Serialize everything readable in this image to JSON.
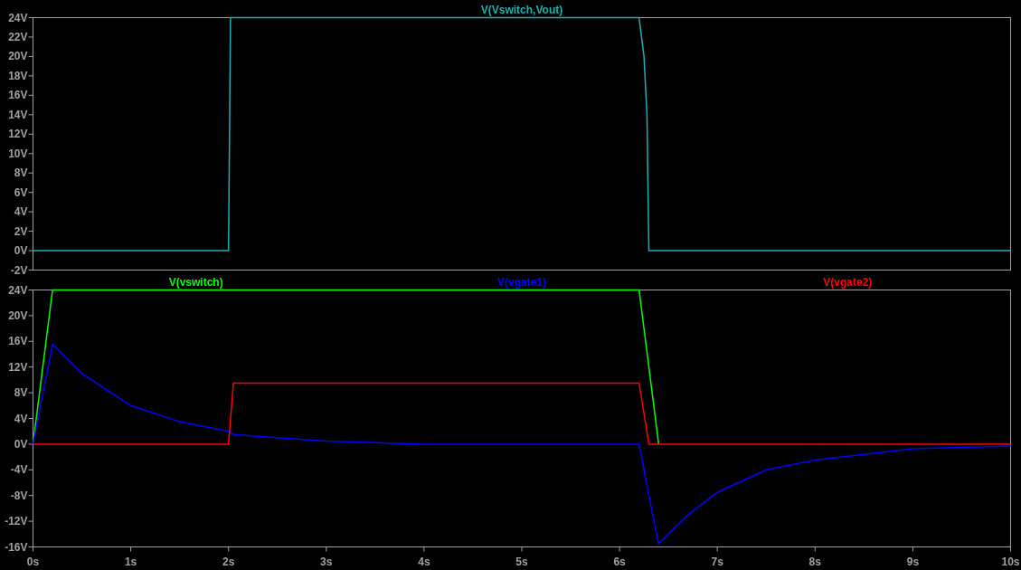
{
  "plots": [
    {
      "chart_data": {
        "type": "line",
        "xlim": [
          0,
          10
        ],
        "ylim": [
          -2,
          24
        ],
        "yticks": [
          {
            "value": 24,
            "label": "24V"
          },
          {
            "value": 22,
            "label": "22V"
          },
          {
            "value": 20,
            "label": "20V"
          },
          {
            "value": 18,
            "label": "18V"
          },
          {
            "value": 16,
            "label": "16V"
          },
          {
            "value": 14,
            "label": "14V"
          },
          {
            "value": 12,
            "label": "12V"
          },
          {
            "value": 10,
            "label": "10V"
          },
          {
            "value": 8,
            "label": "8V"
          },
          {
            "value": 6,
            "label": "6V"
          },
          {
            "value": 4,
            "label": "4V"
          },
          {
            "value": 2,
            "label": "2V"
          },
          {
            "value": 0,
            "label": "0V"
          },
          {
            "value": -2,
            "label": "-2V"
          }
        ],
        "x": [
          0,
          2.0,
          2.02,
          6.2,
          6.25,
          6.28,
          6.3,
          10
        ],
        "series": [
          {
            "name": "V(Vswitch,Vout)",
            "color": "#20b0b0",
            "values": [
              0,
              0,
              24,
              24,
              20,
              14,
              0,
              0
            ]
          }
        ]
      }
    },
    {
      "chart_data": {
        "type": "line",
        "xlim": [
          0,
          10
        ],
        "ylim": [
          -16,
          24
        ],
        "xticks": [
          {
            "value": 0,
            "label": "0s"
          },
          {
            "value": 1,
            "label": "1s"
          },
          {
            "value": 2,
            "label": "2s"
          },
          {
            "value": 3,
            "label": "3s"
          },
          {
            "value": 4,
            "label": "4s"
          },
          {
            "value": 5,
            "label": "5s"
          },
          {
            "value": 6,
            "label": "6s"
          },
          {
            "value": 7,
            "label": "7s"
          },
          {
            "value": 8,
            "label": "8s"
          },
          {
            "value": 9,
            "label": "9s"
          },
          {
            "value": 10,
            "label": "10s"
          }
        ],
        "yticks": [
          {
            "value": 24,
            "label": "24V"
          },
          {
            "value": 20,
            "label": "20V"
          },
          {
            "value": 16,
            "label": "16V"
          },
          {
            "value": 12,
            "label": "12V"
          },
          {
            "value": 8,
            "label": "8V"
          },
          {
            "value": 4,
            "label": "4V"
          },
          {
            "value": 0,
            "label": "0V"
          },
          {
            "value": -4,
            "label": "-4V"
          },
          {
            "value": -8,
            "label": "-8V"
          },
          {
            "value": -12,
            "label": "-12V"
          },
          {
            "value": -16,
            "label": "-16V"
          }
        ],
        "x": [
          0,
          0.2,
          0.5,
          1,
          1.5,
          2,
          2.05,
          2.5,
          3,
          4,
          5,
          6,
          6.2,
          6.3,
          6.4,
          6.7,
          7,
          7.5,
          8,
          9,
          10
        ],
        "series": [
          {
            "name": "V(vswitch)",
            "color": "#00ff00",
            "values": [
              0,
              24,
              24,
              24,
              24,
              24,
              24,
              24,
              24,
              24,
              24,
              24,
              24,
              12,
              0,
              null,
              null,
              null,
              null,
              null,
              null
            ]
          },
          {
            "name": "V(vgate1)",
            "color": "#0000ff",
            "values": [
              0,
              15.5,
              11,
              6,
              3.5,
              2,
              1.5,
              1,
              0.5,
              0,
              0,
              0,
              0,
              -8,
              -15.5,
              -11,
              -7.5,
              -4,
              -2.5,
              -0.7,
              -0.3
            ]
          },
          {
            "name": "V(vgate2)",
            "color": "#ff0000",
            "values": [
              0,
              0,
              0,
              0,
              0,
              0,
              9.5,
              9.5,
              9.5,
              9.5,
              9.5,
              9.5,
              9.5,
              0,
              0,
              0,
              0,
              0,
              0,
              0,
              0
            ]
          }
        ]
      }
    }
  ]
}
